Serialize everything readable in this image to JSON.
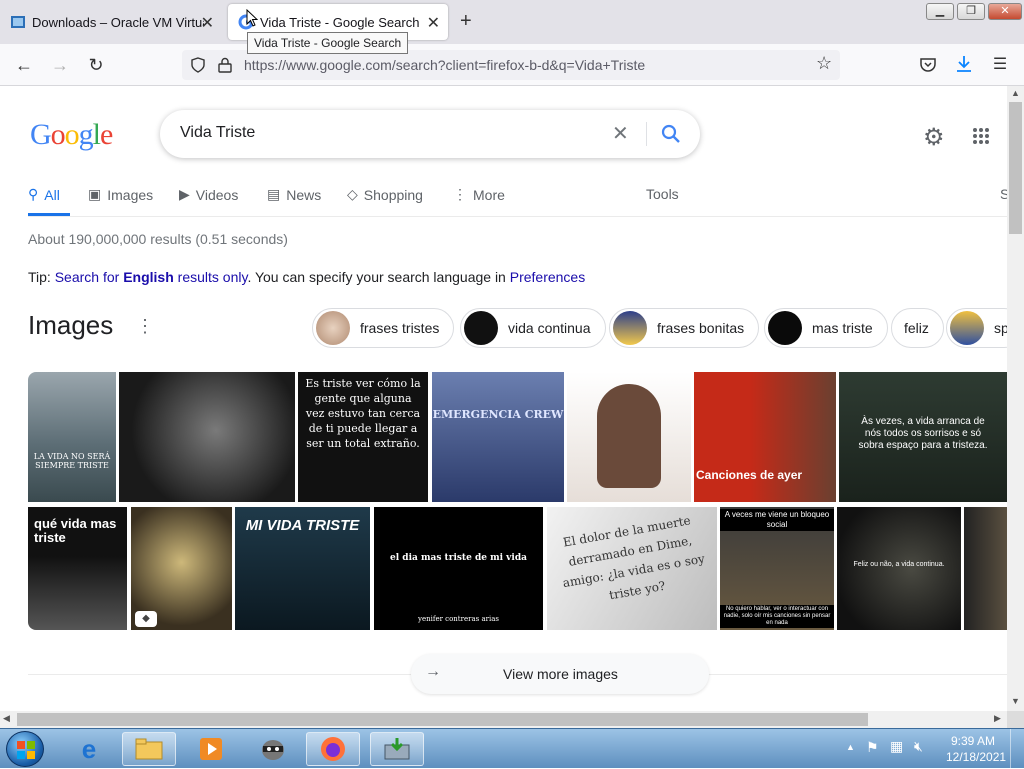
{
  "browser": {
    "tabs": [
      {
        "title": "Downloads – Oracle VM VirtualBox",
        "active": false
      },
      {
        "title": "Vida Triste - Google Search",
        "active": true
      }
    ],
    "tooltip": "Vida Triste - Google Search",
    "url": "https://www.google.com/search?client=firefox-b-d&q=Vida+Triste",
    "new_tab_label": "+"
  },
  "google": {
    "logo": "Google",
    "query": "Vida Triste",
    "nav": [
      {
        "label": "All",
        "icon": "search-icon"
      },
      {
        "label": "Images",
        "icon": "image-icon"
      },
      {
        "label": "Videos",
        "icon": "video-icon"
      },
      {
        "label": "News",
        "icon": "news-icon"
      },
      {
        "label": "Shopping",
        "icon": "tag-icon"
      },
      {
        "label": "More",
        "icon": "more-vert-icon"
      }
    ],
    "tools": "Tools",
    "right_cut": "S",
    "result_stats": "About 190,000,000 results (0.51 seconds)",
    "tip": {
      "prefix": "Tip: ",
      "link1": "Search for ",
      "bold": "English",
      "link2": " results only",
      "middle": ". You can specify your search language in ",
      "prefs": "Preferences"
    },
    "images_heading": "Images",
    "chips": [
      "frases tristes",
      "vida continua",
      "frases bonitas",
      "mas triste",
      "feliz",
      "sp"
    ],
    "image_captions": [
      "LA VIDA NO SERÁ SIEMPRE TRISTE",
      "Es triste ver cómo la gente que alguna vez estuvo tan cerca de ti puede llegar a ser un total extraño.",
      "EMERGENCIA CREW",
      "Canciones de ayer",
      "Às vezes, a vida arranca de nós todos os sorrisos e só sobra espaço para a tristeza.",
      "qué vida mas triste",
      "MI VIDA TRISTE",
      "el dia mas triste de mi vida",
      "yenifer contreras arias",
      "El dolor de la muerte derramado en Dime, amigo: ¿la vida es o soy triste yo?",
      "A veces me viene un bloqueo social",
      "No quiero hablar, ver o interactuar con nadie, solo oír mis canciones sin pensar en nada",
      "Feliz ou não, a vida continua."
    ],
    "view_more": "View more images"
  },
  "taskbar": {
    "time": "9:39 AM",
    "date": "12/18/2021"
  },
  "colors": {
    "link": "#1a0dab",
    "accent": "#1a73e8",
    "taskbar": "#6e9bc8"
  }
}
